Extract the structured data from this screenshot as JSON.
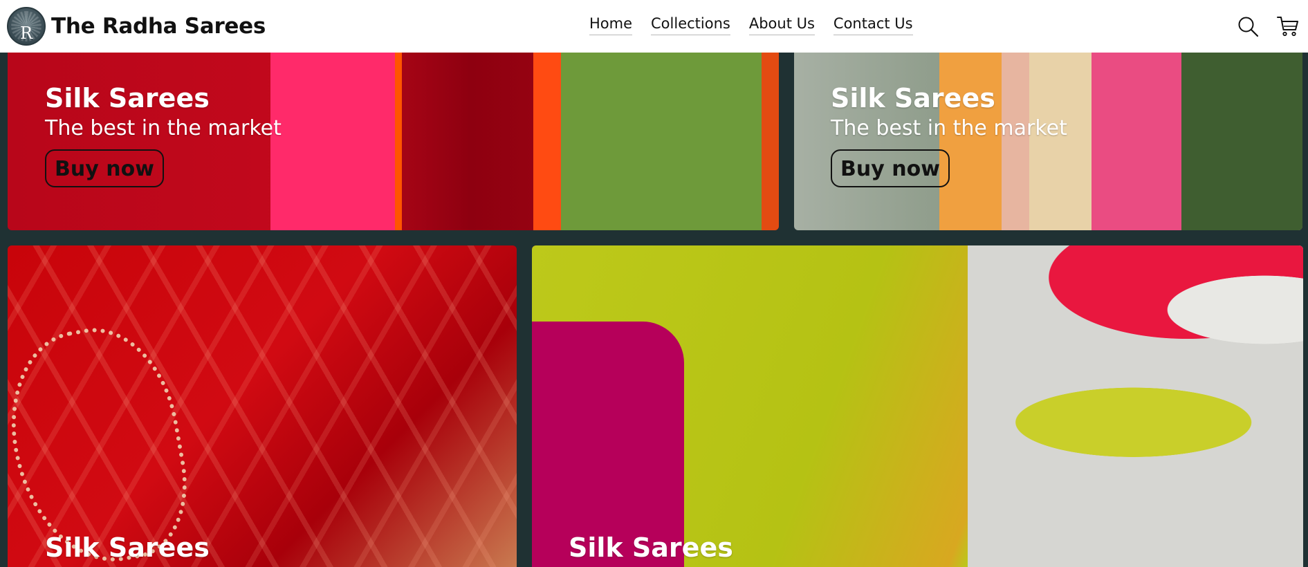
{
  "header": {
    "logo_letter": "R",
    "site_name": "The Radha Sarees",
    "nav": [
      "Home",
      "Collections",
      "About Us",
      "Contact Us"
    ],
    "icons": [
      "search-icon",
      "cart-icon"
    ]
  },
  "banners": [
    {
      "title": "Silk Sarees",
      "subtitle": "The best in the market",
      "button": "Buy now"
    },
    {
      "title": "Silk Sarees",
      "subtitle": "The best in the market",
      "button": "Buy now"
    },
    {
      "title": "Silk Sarees"
    },
    {
      "title": "Silk Sarees"
    }
  ],
  "colors": {
    "page_background": "#1f3133",
    "header_background": "#ffffff",
    "text_dark": "#111111",
    "banner_text": "#ffffff"
  }
}
